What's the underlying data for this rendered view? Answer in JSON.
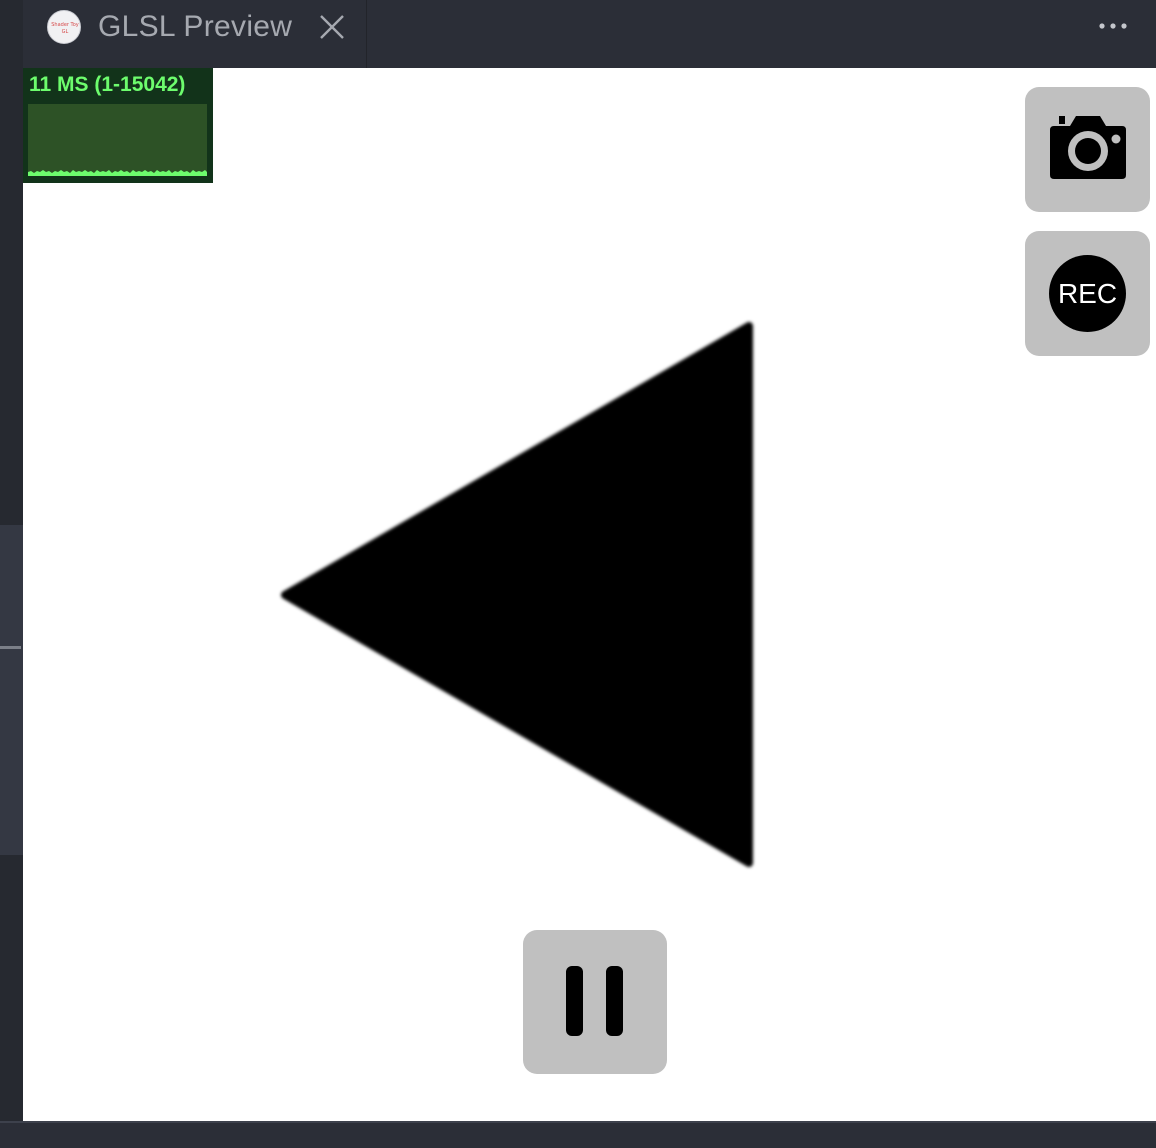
{
  "tab": {
    "title": "GLSL Preview",
    "logo_icon": "shader-toy-logo-icon",
    "close_icon": "close-icon"
  },
  "toolbar": {
    "more_icon": "ellipsis-icon"
  },
  "stats": {
    "label": "11 MS (1-15042)",
    "text_color": "#6dfc6d",
    "bg_color": "#12331a"
  },
  "controls": {
    "screenshot_icon": "camera-icon",
    "record_label": "REC",
    "pause_icon": "pause-icon",
    "button_color": "#c0c0c0"
  },
  "canvas": {
    "background": "#ffffff",
    "shape": "triangle-pointing-left",
    "shape_color": "#000000"
  }
}
